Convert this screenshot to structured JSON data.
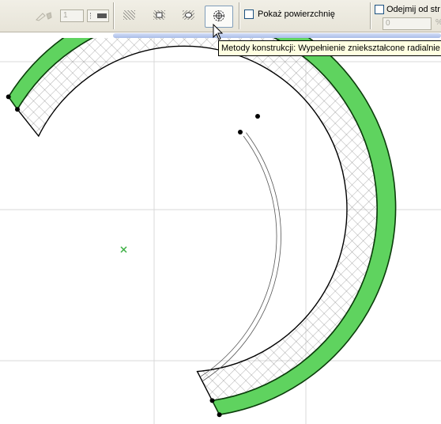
{
  "toolbar": {
    "pen_number": "1",
    "show_surface_label": "Pokaż powierzchnię",
    "subtract_label": "Odejmij od str",
    "subtract_value": "0",
    "percent_unit": "%"
  },
  "tooltip": {
    "text": "Metody konstrukcji: Wypełnienie zniekształcone radialnie"
  },
  "colors": {
    "fill_green": "#5fd35f",
    "selection_dot": "#000000",
    "center_mark": "#3cb043"
  }
}
